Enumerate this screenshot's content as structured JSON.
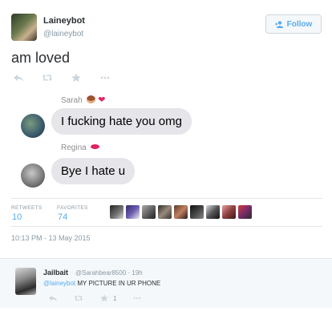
{
  "tweet": {
    "display_name": "Laineybot",
    "handle": "@laineybot",
    "follow_label": "Follow",
    "text": "am loved",
    "timestamp": "10:13 PM - 13 May 2015"
  },
  "embedded_messages": [
    {
      "sender": "Sarah",
      "text": "I fucking hate you omg"
    },
    {
      "sender": "Regina",
      "text": "Bye I hate u"
    }
  ],
  "stats": {
    "retweets_label": "RETWEETS",
    "retweets_value": "10",
    "favorites_label": "FAVORITES",
    "favorites_value": "74"
  },
  "reply": {
    "display_name": "Jailbait",
    "handle_time": "@Sarahbear8500 · 19h",
    "mention": "@laineybot",
    "text": "MY PICTURE IN UR PHONE",
    "favorite_count": "1"
  },
  "colors": {
    "accent": "#55acee",
    "bubble": "#e5e5ea",
    "muted": "#8899a6"
  },
  "icons": [
    "reply-icon",
    "retweet-icon",
    "favorite-icon",
    "more-icon",
    "follow-person-icon",
    "monkey-emoji-icon",
    "heart-emoji-icon",
    "kiss-lips-emoji-icon"
  ]
}
